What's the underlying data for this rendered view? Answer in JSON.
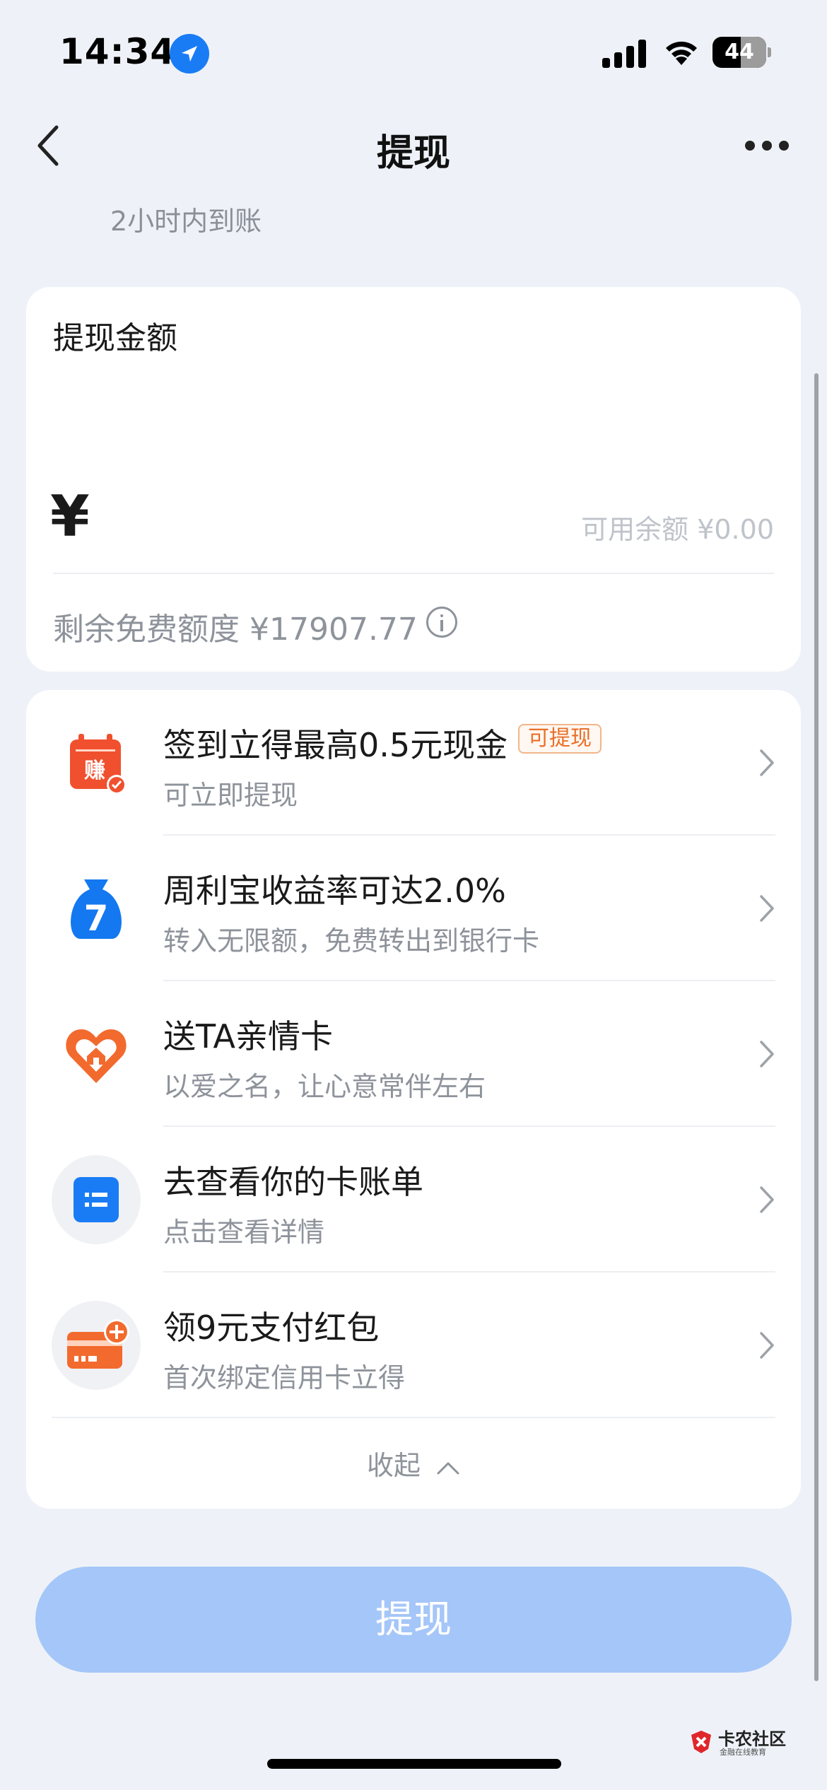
{
  "status_bar": {
    "time": "14:34",
    "battery": "44",
    "icons": [
      "location-arrow-icon",
      "cellular-signal-icon",
      "wifi-icon",
      "battery-icon"
    ]
  },
  "nav": {
    "title": "提现",
    "back_icon": "chevron-left-icon",
    "more_icon": "more-horizontal-icon"
  },
  "subtitle": "2小时内到账",
  "amount_card": {
    "label": "提现金额",
    "currency_symbol": "¥",
    "balance_text": "可用余额 ¥0.00",
    "free_quota_text": "剩余免费额度 ¥17907.77",
    "info_icon": "info-icon"
  },
  "promo_list": [
    {
      "title": "签到立得最高0.5元现金",
      "tag": "可提现",
      "subtitle": "可立即提现",
      "icon": "calendar-earn-icon"
    },
    {
      "title": "周利宝收益率可达2.0%",
      "subtitle": "转入无限额，免费转出到银行卡",
      "icon": "money-bag-7-icon"
    },
    {
      "title": "送TA亲情卡",
      "subtitle": "以爱之名，让心意常伴左右",
      "icon": "heart-house-icon"
    },
    {
      "title": "去查看你的卡账单",
      "subtitle": "点击查看详情",
      "icon": "bill-icon"
    },
    {
      "title": "领9元支付红包",
      "subtitle": "首次绑定信用卡立得",
      "icon": "card-add-icon"
    }
  ],
  "collapse_label": "收起",
  "withdraw_button": "提现",
  "watermark": {
    "name": "卡农社区",
    "tagline": "金融在线教育"
  },
  "colors": {
    "background": "#eef2f8",
    "accent_blue": "#1a7cf5",
    "button_disabled": "#a5c6f8",
    "tag_orange": "#e8702a",
    "icon_red": "#f0502e"
  }
}
